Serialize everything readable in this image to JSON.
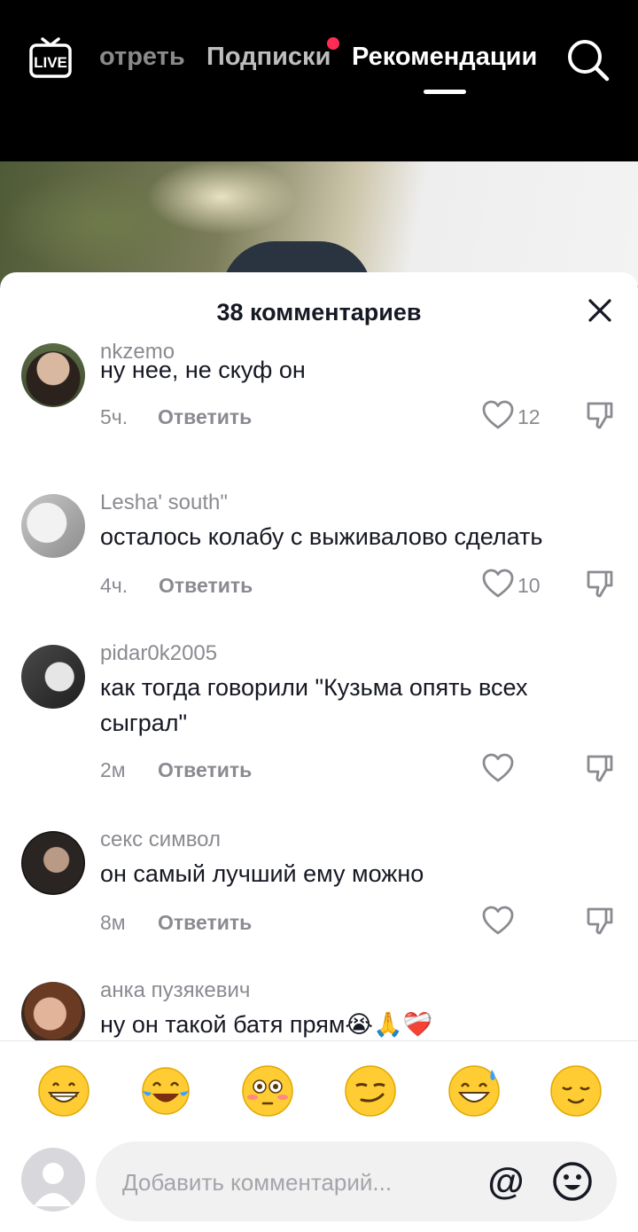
{
  "header": {
    "tabs": [
      {
        "label": "отреть"
      },
      {
        "label": "Подписки"
      },
      {
        "label": "Рекомендации"
      }
    ],
    "live_label": "LIVE"
  },
  "sheet": {
    "title": "38 комментариев",
    "reply_label": "Ответить"
  },
  "comments": [
    {
      "username": "nkzemo",
      "text": "ну нее, не скуф он",
      "time": "5ч.",
      "likes": "12"
    },
    {
      "username": "Lesha' south\"",
      "text": "осталось колабу с выживалово сделать",
      "time": "4ч.",
      "likes": "10"
    },
    {
      "username": "pidar0k2005",
      "text": "как тогда говорили \"Кузьма опять всех сыграл\"",
      "time": "2м",
      "likes": ""
    },
    {
      "username": "секс символ",
      "text": "он самый лучший ему можно",
      "time": "8м",
      "likes": ""
    },
    {
      "username": "анка пузякевич",
      "text": "ну он такой батя прям😭🙏❤️‍🩹",
      "time": "",
      "likes": ""
    }
  ],
  "emoji_bar": [
    "grin",
    "tears-of-joy",
    "flushed",
    "smirk",
    "sweat-smile",
    "relieved"
  ],
  "input": {
    "placeholder": "Добавить комментарий..."
  },
  "colors": {
    "accent_dot": "#ff2d55",
    "muted_text": "#8a8b91",
    "primary_text": "#161823"
  }
}
